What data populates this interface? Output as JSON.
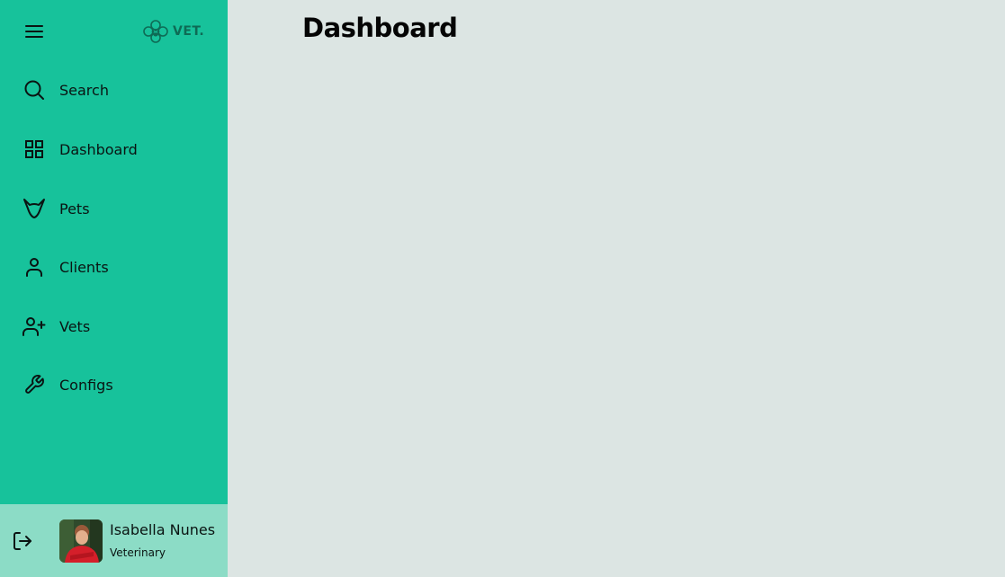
{
  "brand": {
    "logo_text": "VET."
  },
  "sidebar": {
    "items": [
      {
        "label": "Search",
        "icon": "search-icon"
      },
      {
        "label": "Dashboard",
        "icon": "grid-icon"
      },
      {
        "label": "Pets",
        "icon": "cat-icon"
      },
      {
        "label": "Clients",
        "icon": "user-icon"
      },
      {
        "label": "Vets",
        "icon": "user-plus-icon"
      },
      {
        "label": "Configs",
        "icon": "wrench-icon"
      }
    ]
  },
  "profile": {
    "name": "Isabella Nunes",
    "role": "Veterinary"
  },
  "main": {
    "title": "Dashboard"
  },
  "colors": {
    "sidebar_bg": "#17c29b",
    "profile_bg": "#8cdcc6",
    "main_bg": "#dce5e3"
  }
}
